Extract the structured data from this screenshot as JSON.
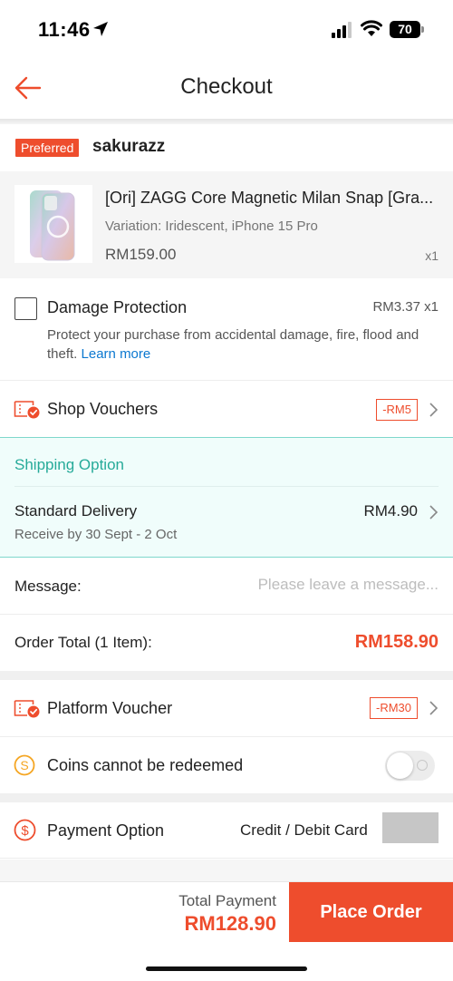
{
  "status_bar": {
    "time": "11:46",
    "battery": "70"
  },
  "nav": {
    "title": "Checkout"
  },
  "shop": {
    "badge": "Preferred",
    "name": "sakurazz"
  },
  "product": {
    "name": "[Ori] ZAGG Core Magnetic Milan Snap [Gra...",
    "variation": "Variation: Iridescent, iPhone 15 Pro",
    "price": "RM159.00",
    "qty": "x1"
  },
  "protection": {
    "title": "Damage Protection",
    "price": "RM3.37  x1",
    "desc": "Protect your purchase from accidental damage, fire, flood and theft.",
    "learn_more": "Learn more"
  },
  "shop_vouchers": {
    "label": "Shop Vouchers",
    "tag": "-RM5"
  },
  "shipping": {
    "title": "Shipping Option",
    "method": "Standard Delivery",
    "price": "RM4.90",
    "date": "Receive by 30 Sept - 2 Oct"
  },
  "message": {
    "label": "Message:",
    "placeholder": "Please leave a message..."
  },
  "order_total": {
    "label": "Order Total (1 Item):",
    "value": "RM158.90"
  },
  "platform_voucher": {
    "label": "Platform Voucher",
    "tag": "-RM30"
  },
  "coins": {
    "label": "Coins cannot be redeemed",
    "toggle_on": false
  },
  "payment": {
    "label": "Payment Option",
    "value": "Credit / Debit Card"
  },
  "footer": {
    "total_label": "Total Payment",
    "total_value": "RM128.90",
    "button": "Place Order"
  },
  "colors": {
    "accent": "#ee4d2d",
    "teal": "#26aa99",
    "link": "#0b78d0"
  }
}
